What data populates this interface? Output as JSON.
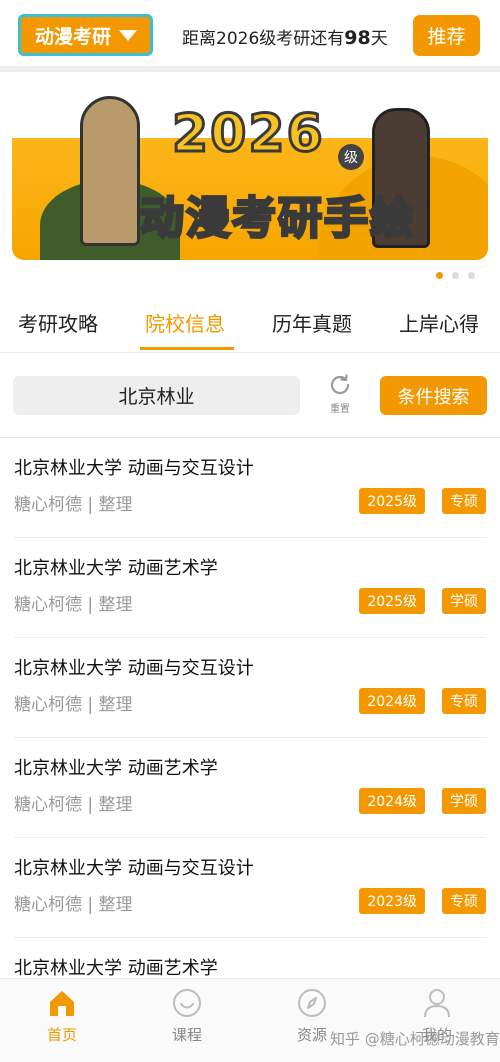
{
  "header": {
    "major_select": "动漫考研",
    "countdown_prefix": "距离2026级考研还有",
    "countdown_days": "98",
    "countdown_suffix": "天",
    "recommend_label": "推荐"
  },
  "banner": {
    "year": "2026",
    "grade": "级",
    "headline": "动漫考研手绘",
    "slide_count": 3,
    "active_slide": 1
  },
  "tabs": [
    {
      "label": "考研攻略",
      "active": false
    },
    {
      "label": "院校信息",
      "active": true
    },
    {
      "label": "历年真题",
      "active": false
    },
    {
      "label": "上岸心得",
      "active": false
    }
  ],
  "search": {
    "value": "北京林业",
    "reset_label": "重置",
    "filter_label": "条件搜索"
  },
  "list": [
    {
      "title": "北京林业大学 动画与交互设计",
      "author": "糖心柯德",
      "sep": "|",
      "action": "整理",
      "year_tag": "2025级",
      "degree_tag": "专硕"
    },
    {
      "title": "北京林业大学 动画艺术学",
      "author": "糖心柯德",
      "sep": "|",
      "action": "整理",
      "year_tag": "2025级",
      "degree_tag": "学硕"
    },
    {
      "title": "北京林业大学 动画与交互设计",
      "author": "糖心柯德",
      "sep": "|",
      "action": "整理",
      "year_tag": "2024级",
      "degree_tag": "专硕"
    },
    {
      "title": "北京林业大学 动画艺术学",
      "author": "糖心柯德",
      "sep": "|",
      "action": "整理",
      "year_tag": "2024级",
      "degree_tag": "学硕"
    },
    {
      "title": "北京林业大学 动画与交互设计",
      "author": "糖心柯德",
      "sep": "|",
      "action": "整理",
      "year_tag": "2023级",
      "degree_tag": "专硕"
    },
    {
      "title": "北京林业大学 动画艺术学"
    }
  ],
  "bottom_nav": [
    {
      "label": "首页",
      "icon": "home-icon",
      "active": true
    },
    {
      "label": "课程",
      "icon": "smile-icon",
      "active": false
    },
    {
      "label": "资源",
      "icon": "compass-icon",
      "active": false
    },
    {
      "label": "我的",
      "icon": "person-icon",
      "active": false
    }
  ],
  "watermark": "知乎 @糖心柯德动漫教育",
  "colors": {
    "accent": "#f39800",
    "select_border": "#39c0d8"
  }
}
